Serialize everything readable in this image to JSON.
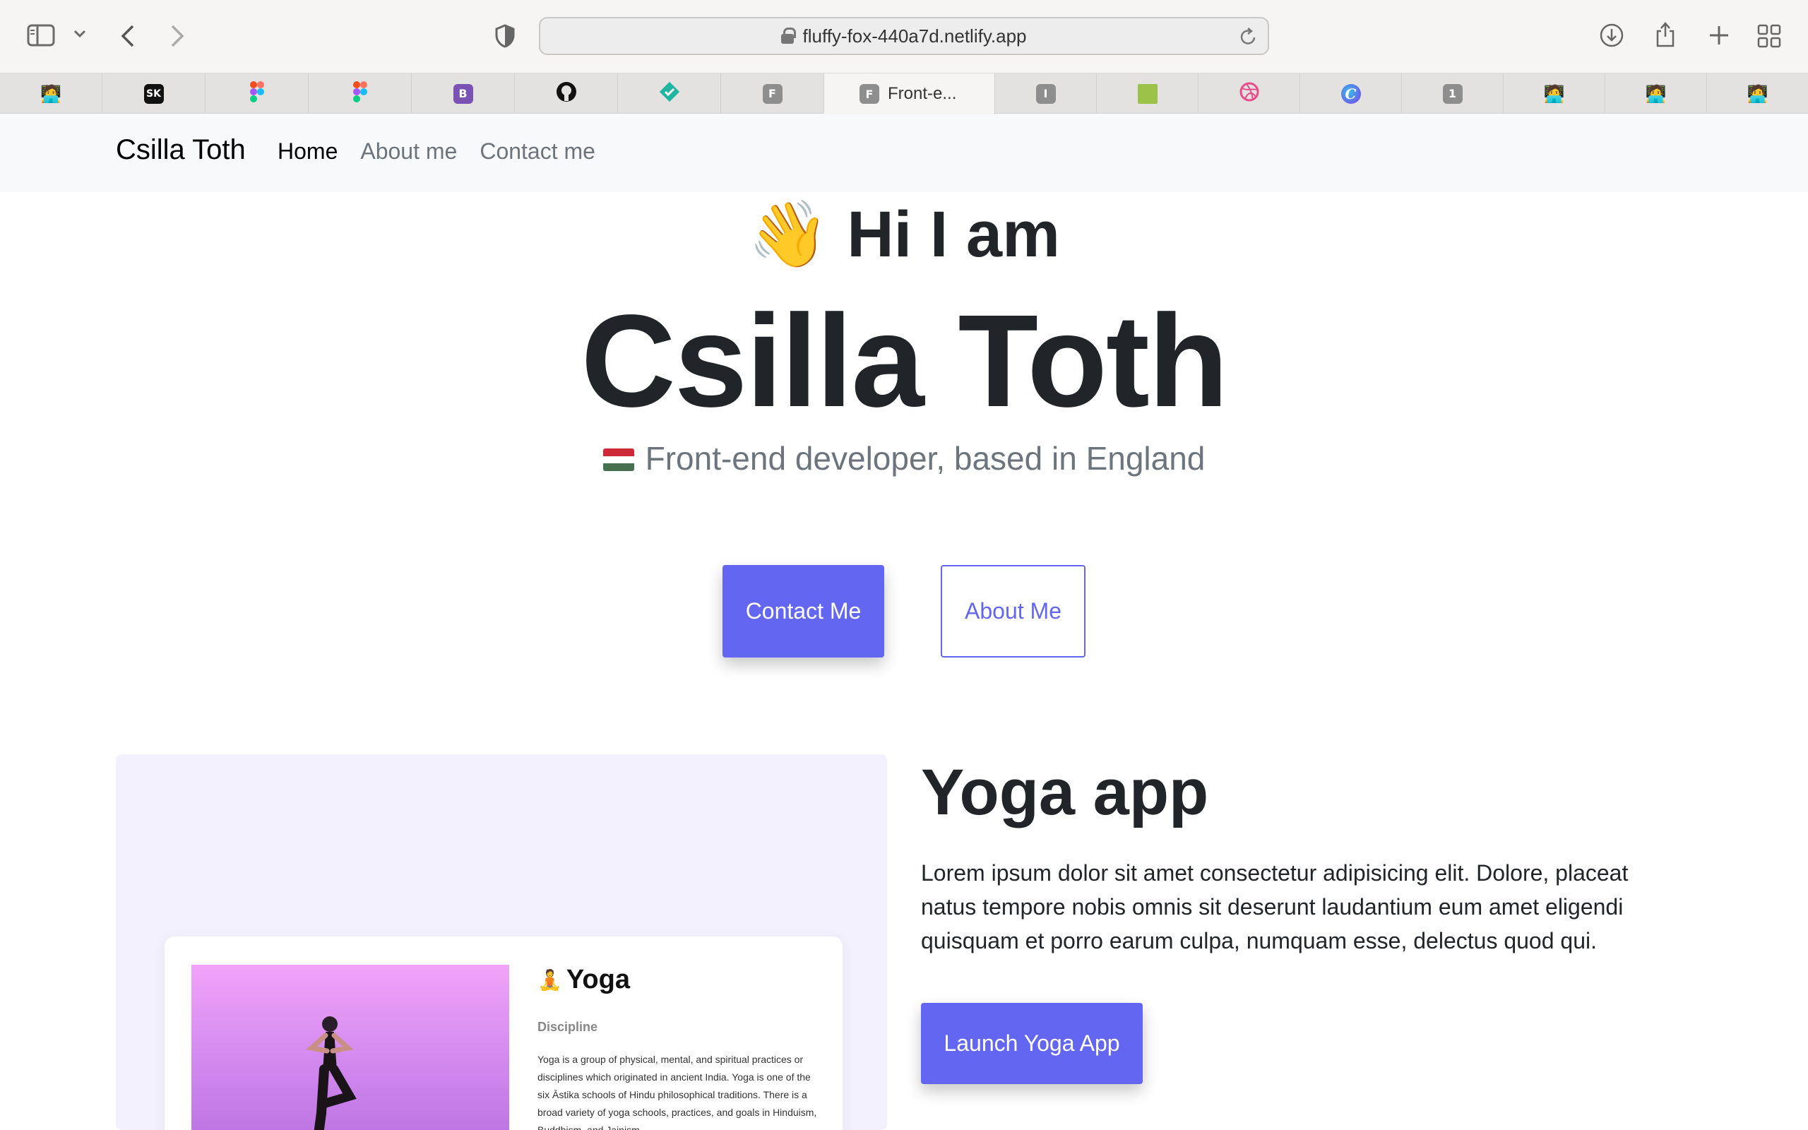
{
  "browser": {
    "url": "fluffy-fox-440a7d.netlify.app",
    "tabs": [
      {
        "icon": "avatar-icon",
        "title": ""
      },
      {
        "icon": "sk-icon",
        "title": "",
        "glyph": "SK"
      },
      {
        "icon": "figma-icon",
        "title": ""
      },
      {
        "icon": "figma-icon",
        "title": ""
      },
      {
        "icon": "bootstrap-icon",
        "title": "",
        "glyph": "B"
      },
      {
        "icon": "github-icon",
        "title": ""
      },
      {
        "icon": "check-diamond-icon",
        "title": ""
      },
      {
        "icon": "f-icon",
        "title": "",
        "glyph": "F"
      },
      {
        "icon": "f-icon",
        "title": "Front-e...",
        "glyph": "F",
        "active": true
      },
      {
        "icon": "i-icon",
        "title": "",
        "glyph": "I"
      },
      {
        "icon": "grid-icon",
        "title": ""
      },
      {
        "icon": "dribbble-icon",
        "title": ""
      },
      {
        "icon": "c-icon",
        "title": "",
        "glyph": "C"
      },
      {
        "icon": "one-icon",
        "title": "",
        "glyph": "1"
      },
      {
        "icon": "avatar-icon",
        "title": ""
      },
      {
        "icon": "avatar-icon",
        "title": ""
      },
      {
        "icon": "avatar-icon",
        "title": ""
      }
    ]
  },
  "nav": {
    "brand": "Csilla Toth",
    "links": [
      "Home",
      "About me",
      "Contact me"
    ]
  },
  "hero": {
    "greeting_emoji": "👋",
    "greeting": "Hi I am",
    "name": "Csilla Toth",
    "subtitle": "Front-end developer, based in England",
    "flag_colors": [
      "#ce2939",
      "#ffffff",
      "#477050"
    ],
    "contact_button": "Contact Me",
    "about_button": "About Me"
  },
  "project": {
    "title": "Yoga app",
    "description": "Lorem ipsum dolor sit amet consectetur adipisicing elit. Dolore, placeat natus tempore nobis omnis sit deserunt laudantium eum amet eligendi quisquam et porro earum culpa, numquam esse, delectus quod qui.",
    "button": "Launch Yoga App",
    "preview": {
      "emoji": "🧘",
      "title": "Yoga",
      "label": "Discipline",
      "text": "Yoga is a group of physical, mental, and spiritual practices or disciplines which originated in ancient India. Yoga is one of the six Āstika schools of Hindu philosophical traditions. There is a broad variety of yoga schools, practices, and goals in Hinduism, Buddhism, and Jainism."
    }
  },
  "colors": {
    "accent": "#6366f1",
    "card_bg": "#f3f1fd"
  }
}
